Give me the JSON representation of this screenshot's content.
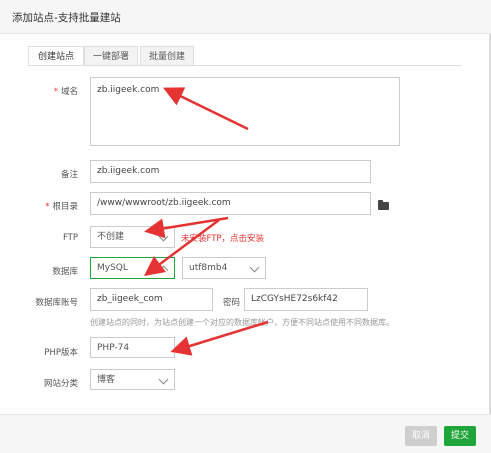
{
  "dialog": {
    "title": "添加站点-支持批量建站"
  },
  "tabs": [
    {
      "label": "创建站点"
    },
    {
      "label": "一键部署"
    },
    {
      "label": "批量创建"
    }
  ],
  "form": {
    "domain": {
      "label": "域名",
      "value": "zb.iigeek.com"
    },
    "remark": {
      "label": "备注",
      "value": "zb.iigeek.com"
    },
    "root": {
      "label": "根目录",
      "value": "/www/wwwroot/zb.iigeek.com"
    },
    "ftp": {
      "label": "FTP",
      "value": "不创建",
      "hint": "未安装FTP，点击安装"
    },
    "database": {
      "label": "数据库",
      "value": "MySQL",
      "charset": "utf8mb4"
    },
    "db_account": {
      "label": "数据库账号",
      "value": "zb_iigeek_com",
      "password_label": "密码",
      "password": "LzCGYsHE72s6kf42",
      "hint": "创建站点的同时，为站点创建一个对应的数据库帐户，方便不同站点使用不同数据库。"
    },
    "php": {
      "label": "PHP版本",
      "value": "PHP-74"
    },
    "category": {
      "label": "网站分类",
      "value": "博客"
    },
    "required_mark": "*"
  },
  "footer": {
    "cancel": "取消",
    "submit": "提交"
  },
  "colors": {
    "accent": "#20a53a",
    "annotation": "#e53333"
  }
}
